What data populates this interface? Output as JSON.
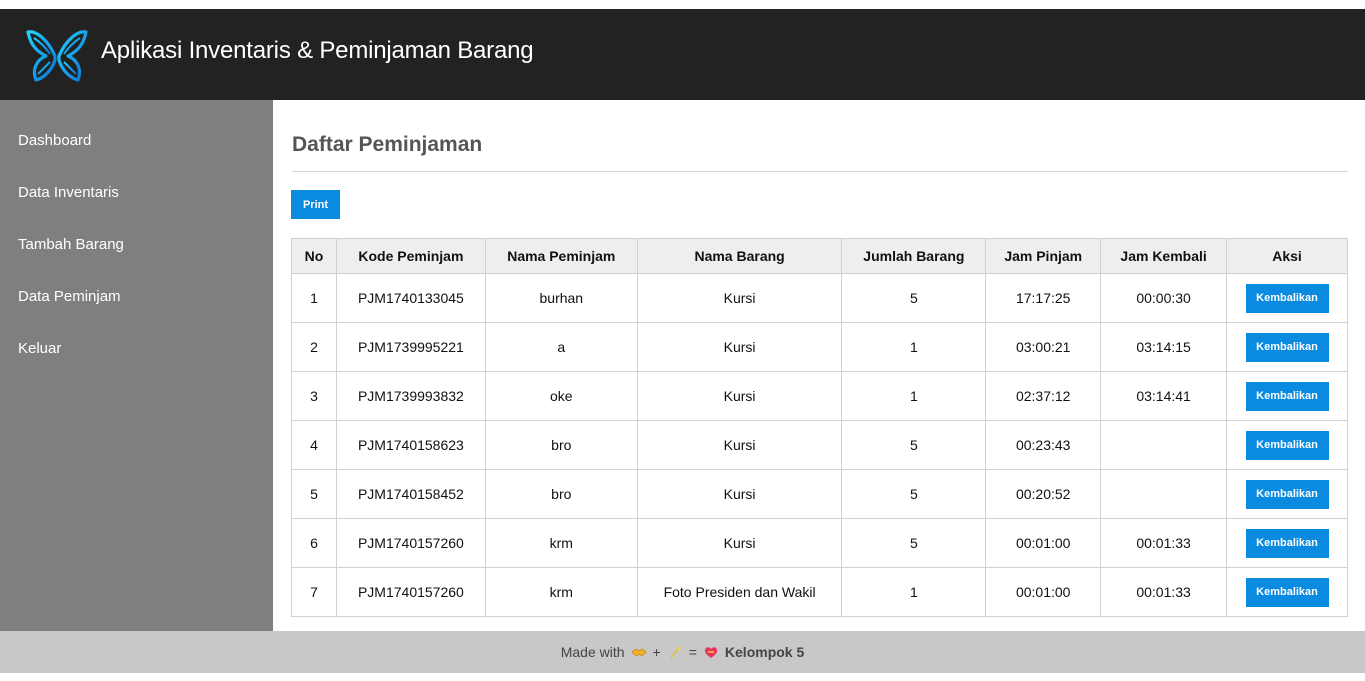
{
  "header": {
    "title": "Aplikasi Inventaris & Peminjaman Barang",
    "logo_icon": "butterfly-logo-icon"
  },
  "sidebar": {
    "items": [
      {
        "label": "Dashboard"
      },
      {
        "label": "Data Inventaris"
      },
      {
        "label": "Tambah Barang"
      },
      {
        "label": "Data Peminjam"
      },
      {
        "label": "Keluar"
      }
    ]
  },
  "main": {
    "title": "Daftar Peminjaman",
    "print_label": "Print",
    "columns": [
      "No",
      "Kode Peminjam",
      "Nama Peminjam",
      "Nama Barang",
      "Jumlah Barang",
      "Jam Pinjam",
      "Jam Kembali",
      "Aksi"
    ],
    "rows": [
      {
        "no": "1",
        "kode": "PJM1740133045",
        "nama": "burhan",
        "barang": "Kursi",
        "jumlah": "5",
        "pinjam": "17:17:25",
        "kembali": "00:00:30",
        "aksi": "Kembalikan"
      },
      {
        "no": "2",
        "kode": "PJM1739995221",
        "nama": "a",
        "barang": "Kursi",
        "jumlah": "1",
        "pinjam": "03:00:21",
        "kembali": "03:14:15",
        "aksi": "Kembalikan"
      },
      {
        "no": "3",
        "kode": "PJM1739993832",
        "nama": "oke",
        "barang": "Kursi",
        "jumlah": "1",
        "pinjam": "02:37:12",
        "kembali": "03:14:41",
        "aksi": "Kembalikan"
      },
      {
        "no": "4",
        "kode": "PJM1740158623",
        "nama": "bro",
        "barang": "Kursi",
        "jumlah": "5",
        "pinjam": "00:23:43",
        "kembali": "",
        "aksi": "Kembalikan"
      },
      {
        "no": "5",
        "kode": "PJM1740158452",
        "nama": "bro",
        "barang": "Kursi",
        "jumlah": "5",
        "pinjam": "00:20:52",
        "kembali": "",
        "aksi": "Kembalikan"
      },
      {
        "no": "6",
        "kode": "PJM1740157260",
        "nama": "krm",
        "barang": "Kursi",
        "jumlah": "5",
        "pinjam": "00:01:00",
        "kembali": "00:01:33",
        "aksi": "Kembalikan"
      },
      {
        "no": "7",
        "kode": "PJM1740157260",
        "nama": "krm",
        "barang": "Foto Presiden dan Wakil",
        "jumlah": "1",
        "pinjam": "00:01:00",
        "kembali": "00:01:33",
        "aksi": "Kembalikan"
      }
    ]
  },
  "footer": {
    "made_with": "Made with",
    "plus": "+",
    "equals": "=",
    "team": "Kelompok 5",
    "icons": [
      "handshake-icon",
      "sparkle-icon",
      "heart-icon"
    ]
  },
  "colors": {
    "header_bg": "#222222",
    "sidebar_bg": "#7f7f7f",
    "accent": "#0b8be0",
    "footer_bg": "#c8c8c8"
  }
}
